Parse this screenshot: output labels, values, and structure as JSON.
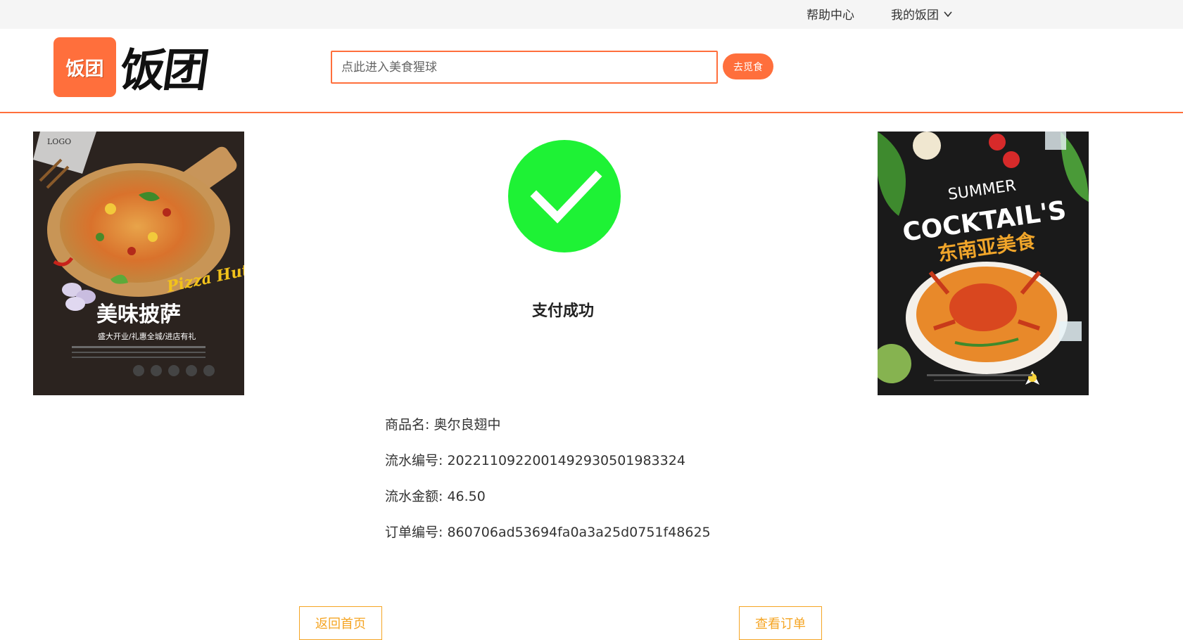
{
  "topbar": {
    "help_label": "帮助中心",
    "my_label": "我的饭团",
    "my_icon": "chevron-down-icon"
  },
  "header": {
    "logo_badge_text": "饭团",
    "logo_text": "饭团",
    "search_placeholder": "点此进入美食猩球",
    "search_button": "去觅食"
  },
  "posters": {
    "left": {
      "logo_label": "LOGO",
      "brand": "Pizza Hut",
      "title": "美味披萨",
      "subtitle": "盛大开业/礼惠全城/进店有礼"
    },
    "right": {
      "line1": "SUMMER",
      "line2": "COCKTAIL'S",
      "title": "东南亚美食"
    }
  },
  "result": {
    "status_icon": "check-circle-icon",
    "status_color": "#1ef235",
    "title": "支付成功"
  },
  "details": {
    "product": "商品名: 奥尔良翅中",
    "serial_no": "流水编号: 2022110922001492930501983324",
    "amount": "流水金额: 46.50",
    "order_no": "订单编号: 860706ad53694fa0a3a25d0751f48625"
  },
  "actions": {
    "home_label": "返回首页",
    "order_label": "查看订单"
  },
  "colors": {
    "accent": "#ff6f3c",
    "button_outline": "#f5a524"
  }
}
